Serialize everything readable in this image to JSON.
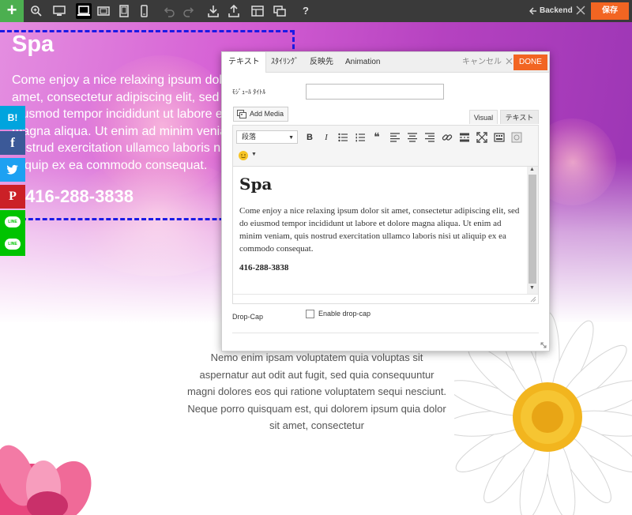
{
  "toolbar": {
    "add_label": "+",
    "backend_label": "Backend",
    "save_label": "保存",
    "icons": [
      "plus-icon",
      "zoom-icon",
      "desktop-icon",
      "laptop-icon",
      "tablet-landscape-icon",
      "tablet-portrait-icon",
      "mobile-icon",
      "undo-icon",
      "redo-icon",
      "import-icon",
      "export-icon",
      "layout-icon",
      "duplicate-icon",
      "help-icon"
    ],
    "help_label": "?",
    "colors": {
      "bar": "#3a3a3a",
      "add": "#4caf50",
      "save": "#f26522"
    }
  },
  "hero": {
    "title": "Spa",
    "lines": [
      "Come enjoy a nice relaxing ipsum dolor sit",
      "amet, consectetur adipiscing elit, sed do",
      "eiusmod tempor incididunt ut labore et dolore",
      "magna aliqua. Ut enim ad minim veniam, quis",
      "nostrud exercitation ullamco laboris nisi ut",
      "aliquip ex ea commodo consequat."
    ],
    "phone": "416-288-3838",
    "selection_color": "#1a1ae6"
  },
  "social": [
    {
      "label": "B!",
      "color": "#00a4de",
      "icon": "hatena-bookmark-icon"
    },
    {
      "label": "f",
      "color": "#3b5998",
      "icon": "facebook-icon"
    },
    {
      "label": "",
      "color": "#1da1f2",
      "icon": "twitter-icon"
    },
    {
      "label": "P",
      "color": "#cb2027",
      "icon": "pinterest-icon"
    },
    {
      "label": "LINE",
      "color": "#00c300",
      "icon": "line-icon"
    },
    {
      "label": "LINE",
      "color": "#00c300",
      "icon": "line-icon"
    }
  ],
  "body": {
    "lines": [
      "Nemo enim ipsam voluptatem quia voluptas sit",
      "aspernatur aut odit aut fugit, sed quia consequuntur",
      "magni dolores eos qui ratione voluptatem sequi nesciunt.",
      "Neque porro quisquam est, qui dolorem ipsum quia dolor",
      "sit amet, consectetur"
    ]
  },
  "modal": {
    "tabs": [
      "テキスト",
      "ｽﾀｲﾘﾝｸﾞ",
      "反映先",
      "Animation"
    ],
    "cancel_label": "キャンセル",
    "done_label": "DONE",
    "module_title_label": "ﾓｼﾞｭｰﾙ ﾀｲﾄﾙ",
    "module_title_value": "",
    "add_media_label": "Add Media",
    "editor_tabs": [
      "Visual",
      "テキスト"
    ],
    "format_select": "段落",
    "editor_icons": [
      "bold-icon",
      "italic-icon",
      "bullet-list-icon",
      "numbered-list-icon",
      "blockquote-icon",
      "align-left-icon",
      "align-center-icon",
      "align-right-icon",
      "link-icon",
      "read-more-icon",
      "fullscreen-icon",
      "toolbar-toggle-icon",
      "add-icon-icon",
      "emoji-icon"
    ],
    "bold_label": "B",
    "italic_label": "I",
    "quote_label": "❝",
    "content": {
      "heading": "Spa",
      "paragraph": "Come enjoy a nice relaxing ipsum dolor sit amet, consectetur adipiscing elit, sed do eiusmod tempor incididunt ut labore et dolore magna aliqua. Ut enim ad minim veniam, quis nostrud exercitation ullamco laboris nisi ut aliquip ex ea commodo consequat.",
      "phone": "416-288-3838"
    },
    "dropcap_label": "Drop-Cap",
    "dropcap_checkbox_label": "Enable drop-cap",
    "dropcap_checked": false
  }
}
